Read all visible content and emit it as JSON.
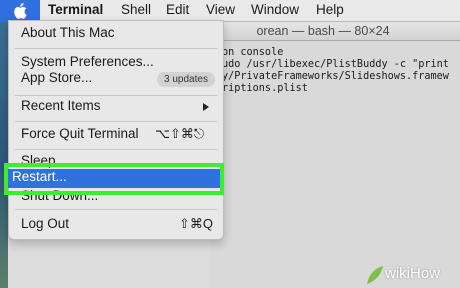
{
  "menubar": {
    "apple_icon": "apple-logo-icon",
    "items": [
      "Terminal",
      "Shell",
      "Edit",
      "View",
      "Window",
      "Help"
    ]
  },
  "terminal": {
    "title": "orean — bash — 80×24",
    "lines": [
      "on console",
      "udo /usr/libexec/PlistBuddy -c \"print",
      "y/PrivateFrameworks/Slideshows.framew",
      "riptions.plist"
    ]
  },
  "apple_menu": {
    "about": "About This Mac",
    "system_preferences": "System Preferences...",
    "app_store": "App Store...",
    "app_store_badge": "3 updates",
    "recent_items": "Recent Items",
    "force_quit": "Force Quit Terminal",
    "force_quit_shortcut": "⌥⇧⌘⎋",
    "sleep": "Sleep",
    "restart": "Restart...",
    "shut_down": "Shut Down...",
    "log_out": "Log Out",
    "log_out_shortcut": "⇧⌘Q"
  },
  "colors": {
    "highlight_green": "#3ded34",
    "selection_blue": "#2f72dd"
  },
  "watermark": {
    "text": "wikiHow"
  }
}
